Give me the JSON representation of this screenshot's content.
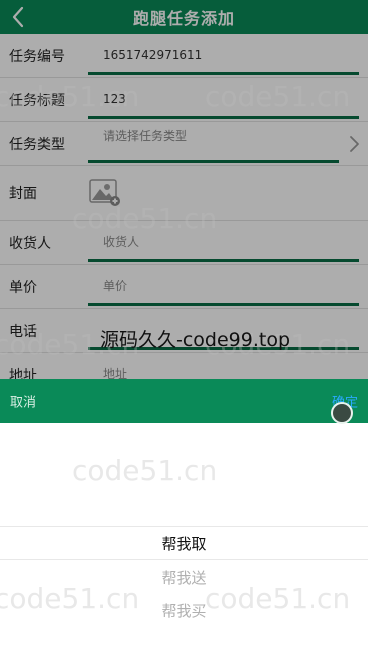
{
  "header": {
    "title": "跑腿任务添加"
  },
  "form": {
    "task_no": {
      "label": "任务编号",
      "value": "1651742971611"
    },
    "task_title": {
      "label": "任务标题",
      "value": "123"
    },
    "task_type": {
      "label": "任务类型",
      "placeholder": "请选择任务类型"
    },
    "cover": {
      "label": "封面"
    },
    "receiver": {
      "label": "收货人",
      "placeholder": "收货人"
    },
    "price": {
      "label": "单价",
      "placeholder": "单价"
    },
    "phone": {
      "label": "电话"
    },
    "address": {
      "label": "地址",
      "placeholder": "地址"
    }
  },
  "picker": {
    "cancel_label": "取消",
    "confirm_label": "确定",
    "options": [
      "帮我取",
      "帮我送",
      "帮我买"
    ],
    "selected_index": 0
  },
  "overlay": {
    "banner": "源码久久-code99.top",
    "watermark": "code51.cn"
  },
  "colors": {
    "brand_green": "#0a8a58",
    "field_underline": "#0a6e46",
    "confirm_blue": "#2aa9ff"
  }
}
